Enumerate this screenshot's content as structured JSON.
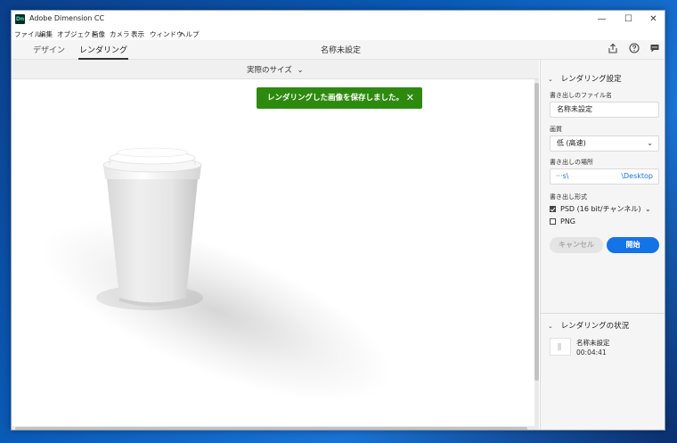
{
  "window": {
    "app_icon": "Dn",
    "title": "Adobe Dimension CC",
    "controls": {
      "minimize": "—",
      "maximize": "☐",
      "close": "✕"
    }
  },
  "menu": [
    "ファイル",
    "編集",
    "オブジェクト",
    "画像",
    "カメラ",
    "表示",
    "ウィンドウ",
    "ヘルプ"
  ],
  "tabs": {
    "design": "デザイン",
    "render": "レンダリング"
  },
  "document_title": "名称未設定",
  "top_icons": [
    "share-icon",
    "help-icon",
    "feedback-icon"
  ],
  "viewport": {
    "zoom_label": "実際のサイズ",
    "toast": {
      "message": "レンダリングした画像を保存しました。",
      "close": "✕"
    }
  },
  "render_settings": {
    "heading": "レンダリング設定",
    "filename_label": "書き出しのファイル名",
    "filename_value": "名称未設定",
    "quality_label": "画質",
    "quality_value": "低 (高速)",
    "location_label": "書き出しの場所",
    "location_left": "···s\\",
    "location_right": "\\Desktop",
    "format_label": "書き出し形式",
    "formats": [
      {
        "label": "PSD (16 bit/チャンネル)",
        "checked": true
      },
      {
        "label": "PNG",
        "checked": false
      }
    ],
    "cancel_label": "キャンセル",
    "start_label": "開始"
  },
  "render_status": {
    "heading": "レンダリングの状況",
    "job_name": "名称未設定",
    "job_time": "00:04:41"
  },
  "colors": {
    "toast_bg": "#2d8a0f",
    "primary_button": "#1473e6",
    "path_text": "#1a73e8"
  }
}
